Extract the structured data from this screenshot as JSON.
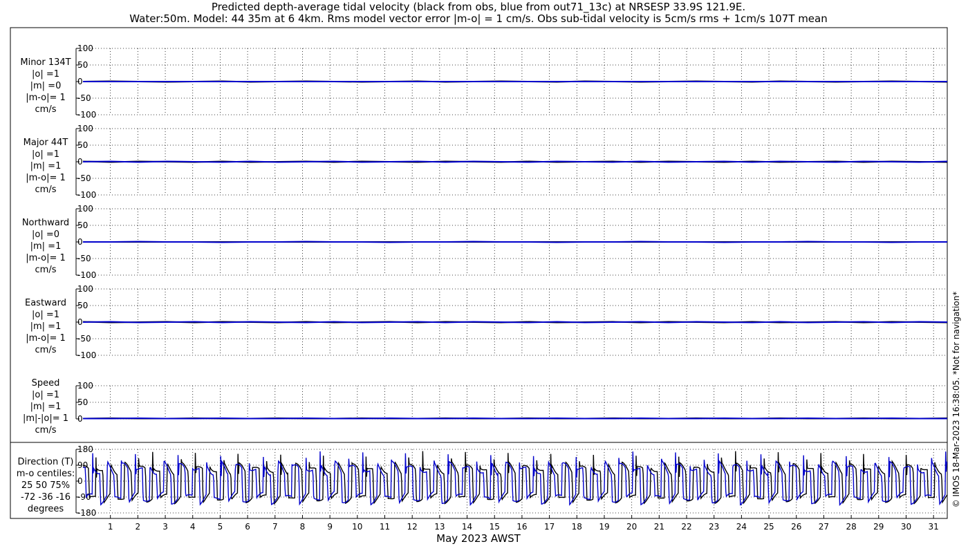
{
  "title_line1": "Predicted depth-average tidal velocity (black from obs, blue from out71_13c) at NRSESP 33.9S 121.9E.",
  "title_line2": "Water:50m. Model: 44 35m at 6 4km. Rms model vector error |m-o| = 1 cm/s. Obs sub-tidal velocity is 5cm/s rms + 1cm/s 107T mean",
  "watermark": "© IMOS 18-Mar-2023 16:38:05. *Not for navigation*",
  "chart_data": {
    "type": "line",
    "xlabel": "May 2023 AWST",
    "x_range": [
      0,
      31.5
    ],
    "x_ticks": [
      1,
      2,
      3,
      4,
      5,
      6,
      7,
      8,
      9,
      10,
      11,
      12,
      13,
      14,
      15,
      16,
      17,
      18,
      19,
      20,
      21,
      22,
      23,
      24,
      25,
      26,
      27,
      28,
      29,
      30,
      31
    ],
    "grid": true,
    "series_colors": {
      "obs": "#000000",
      "model": "#0000cc"
    },
    "panels": [
      {
        "label_lines": [
          "Minor 134T",
          "|o| =1",
          "|m| =0",
          "|m-o|= 1",
          "cm/s"
        ],
        "yticks": [
          "100",
          "50",
          "0",
          "-50",
          "-100"
        ],
        "ytick_values": [
          100,
          50,
          0,
          -50,
          -100
        ],
        "ylim": [
          -100,
          100
        ],
        "obs": [
          0,
          1,
          0,
          -1,
          0,
          1,
          -1,
          0,
          1,
          0,
          -1,
          0,
          1,
          -1,
          0,
          1,
          0,
          -1,
          1,
          0,
          -1,
          0,
          1,
          0,
          -1,
          1,
          0,
          -1,
          0,
          1,
          0,
          -1
        ],
        "model": [
          0,
          0,
          0,
          0,
          0,
          0,
          0,
          0,
          0,
          0,
          0,
          0,
          0,
          0,
          0,
          0,
          0,
          0,
          0,
          0,
          0,
          0,
          0,
          0,
          0,
          0,
          0,
          0,
          0,
          0,
          0,
          0
        ]
      },
      {
        "label_lines": [
          "Major 44T",
          "|o| =1",
          "|m| =1",
          "|m-o|= 1",
          "cm/s"
        ],
        "yticks": [
          "100",
          "50",
          "0",
          "-50",
          "-100"
        ],
        "ytick_values": [
          100,
          50,
          0,
          -50,
          -100
        ],
        "ylim": [
          -100,
          100
        ],
        "obs": [
          1,
          -1,
          1,
          0,
          -1,
          1,
          -1,
          0,
          1,
          -1,
          1,
          0,
          -1,
          1,
          0,
          -1,
          1,
          -1,
          0,
          1,
          -1,
          1,
          0,
          -1,
          1,
          -1,
          0,
          1,
          -1,
          1,
          0,
          -1
        ],
        "model": [
          0,
          1,
          -1,
          1,
          0,
          -1,
          1,
          -1,
          0,
          1,
          -1,
          0,
          1,
          -1,
          1,
          0,
          -1,
          1,
          0,
          -1,
          1,
          -1,
          0,
          1,
          -1,
          1,
          0,
          -1,
          1,
          0,
          -1,
          1
        ]
      },
      {
        "label_lines": [
          "Northward",
          "|o| =0",
          "|m| =1",
          "|m-o|= 1",
          "cm/s"
        ],
        "yticks": [
          "100",
          "50",
          "0",
          "-50",
          "-100"
        ],
        "ytick_values": [
          100,
          50,
          0,
          -50,
          -100
        ],
        "ylim": [
          -100,
          100
        ],
        "obs": [
          0,
          0,
          0,
          0,
          0,
          0,
          0,
          0,
          0,
          0,
          0,
          0,
          0,
          0,
          0,
          0,
          0,
          0,
          0,
          0,
          0,
          0,
          0,
          0,
          0,
          0,
          0,
          0,
          0,
          0,
          0,
          0
        ],
        "model": [
          0,
          0,
          1,
          0,
          0,
          -1,
          0,
          0,
          1,
          0,
          0,
          -1,
          0,
          0,
          1,
          0,
          0,
          -1,
          0,
          0,
          1,
          0,
          0,
          -1,
          0,
          0,
          1,
          0,
          0,
          -1,
          0,
          0
        ]
      },
      {
        "label_lines": [
          "Eastward",
          "|o| =1",
          "|m| =1",
          "|m-o|= 1",
          "cm/s"
        ],
        "yticks": [
          "100",
          "50",
          "0",
          "-50",
          "-100"
        ],
        "ytick_values": [
          100,
          50,
          0,
          -50,
          -100
        ],
        "ylim": [
          -100,
          100
        ],
        "obs": [
          1,
          -1,
          0,
          1,
          -1,
          1,
          0,
          -1,
          1,
          -1,
          0,
          1,
          -1,
          1,
          0,
          -1,
          1,
          -1,
          0,
          1,
          -1,
          1,
          0,
          -1,
          1,
          -1,
          0,
          1,
          -1,
          1,
          0,
          -1
        ],
        "model": [
          0,
          1,
          -1,
          0,
          1,
          -1,
          1,
          0,
          -1,
          1,
          -1,
          0,
          1,
          -1,
          1,
          0,
          -1,
          1,
          -1,
          0,
          1,
          -1,
          1,
          0,
          -1,
          1,
          -1,
          0,
          1,
          -1,
          1,
          0
        ]
      },
      {
        "label_lines": [
          "Speed",
          "|o| =1",
          "|m| =1",
          "|m|-|o|= 1",
          "cm/s"
        ],
        "yticks": [
          "100",
          "50",
          "0"
        ],
        "ytick_values": [
          100,
          50,
          0
        ],
        "ylim": [
          0,
          100
        ],
        "obs": [
          1,
          2,
          1,
          1,
          2,
          1,
          1,
          2,
          1,
          1,
          2,
          1,
          1,
          2,
          1,
          1,
          2,
          1,
          1,
          2,
          1,
          1,
          2,
          1,
          1,
          2,
          1,
          1,
          2,
          1,
          1,
          2
        ],
        "model": [
          1,
          1,
          2,
          1,
          1,
          2,
          1,
          1,
          2,
          1,
          1,
          2,
          1,
          1,
          2,
          1,
          1,
          2,
          1,
          1,
          2,
          1,
          1,
          2,
          1,
          1,
          2,
          1,
          1,
          2,
          1,
          1
        ]
      },
      {
        "label_lines": [
          "Direction (T)",
          "m-o centiles:",
          "25  50  75%",
          "-72 -36 -16",
          "degrees"
        ],
        "yticks": [
          "180",
          "90",
          "0",
          "-90",
          "-180"
        ],
        "ytick_values": [
          180,
          90,
          0,
          -90,
          -180
        ],
        "ylim": [
          -180,
          180
        ],
        "direction_pattern": true
      }
    ]
  }
}
